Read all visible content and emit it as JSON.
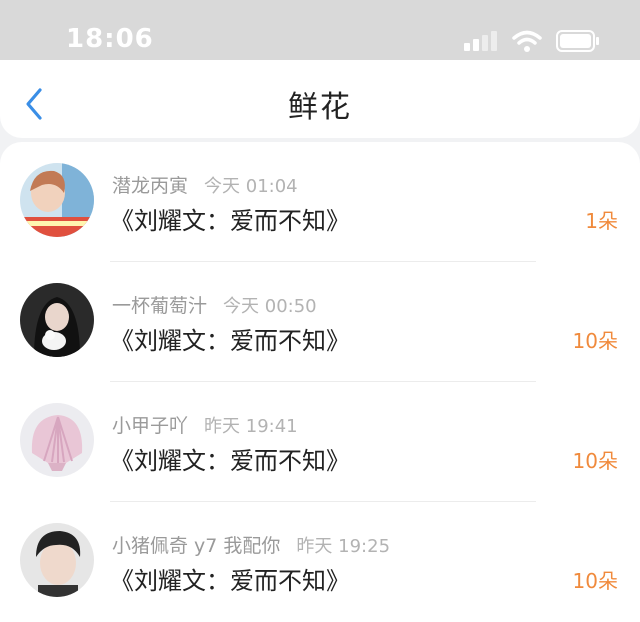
{
  "status": {
    "time": "18:06"
  },
  "header": {
    "title": "鲜花"
  },
  "rows": [
    {
      "name": "潜龙丙寅",
      "time": "今天 01:04",
      "book": "《刘耀文：爱而不知》",
      "count": "1朵"
    },
    {
      "name": "一杯葡萄汁",
      "time": "今天 00:50",
      "book": "《刘耀文：爱而不知》",
      "count": "10朵"
    },
    {
      "name": "小甲子吖",
      "time": "昨天 19:41",
      "book": "《刘耀文：爱而不知》",
      "count": "10朵"
    },
    {
      "name": "小猪佩奇 y7 我配你",
      "time": "昨天 19:25",
      "book": "《刘耀文：爱而不知》",
      "count": "10朵"
    }
  ],
  "colors": {
    "accent": "#f08a3c",
    "back": "#3a8ee6"
  },
  "icons": [
    "signal-icon",
    "wifi-icon",
    "battery-icon",
    "back-arrow-icon"
  ]
}
